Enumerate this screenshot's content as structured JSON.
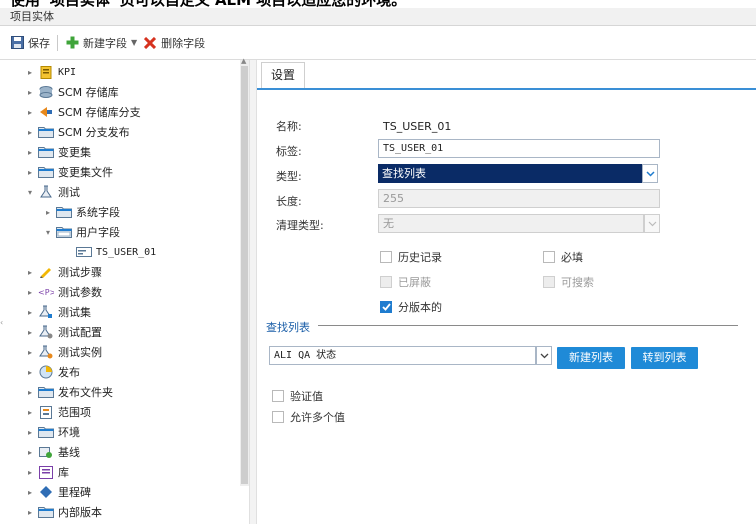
{
  "banner": {
    "text": "使用“项目实体”页可以自定义 ALM 项目以适应您的环境。"
  },
  "window": {
    "title": "项目实体"
  },
  "toolbar": {
    "save_label": "保存",
    "new_field_label": "新建字段",
    "delete_field_label": "删除字段"
  },
  "tree": {
    "items": [
      {
        "label": "KPI",
        "icon": "kpi-icon",
        "expander": "▸"
      },
      {
        "label": "SCM 存储库",
        "icon": "scm-repository-icon",
        "expander": "▸"
      },
      {
        "label": "SCM 存储库分支",
        "icon": "scm-branch-icon",
        "expander": "▸"
      },
      {
        "label": "SCM 分支发布",
        "icon": "folder-icon",
        "expander": "▸"
      },
      {
        "label": "变更集",
        "icon": "folder-icon",
        "expander": "▸"
      },
      {
        "label": "变更集文件",
        "icon": "folder-icon",
        "expander": "▸"
      },
      {
        "label": "测试",
        "icon": "test-icon",
        "expander": "▾"
      },
      {
        "label": "系统字段",
        "icon": "folder-icon",
        "expander": "▸"
      },
      {
        "label": "用户字段",
        "icon": "folder-open-icon",
        "expander": "▾"
      },
      {
        "label": "TS_USER_01",
        "icon": "field-icon",
        "expander": ""
      },
      {
        "label": "测试步骤",
        "icon": "test-step-icon",
        "expander": "▸"
      },
      {
        "label": "测试参数",
        "icon": "parameter-icon",
        "expander": "▸"
      },
      {
        "label": "测试集",
        "icon": "test-set-icon",
        "expander": "▸"
      },
      {
        "label": "测试配置",
        "icon": "test-config-icon",
        "expander": "▸"
      },
      {
        "label": "测试实例",
        "icon": "test-instance-icon",
        "expander": "▸"
      },
      {
        "label": "发布",
        "icon": "release-icon",
        "expander": "▸"
      },
      {
        "label": "发布文件夹",
        "icon": "folder-icon",
        "expander": "▸"
      },
      {
        "label": "范围项",
        "icon": "scope-item-icon",
        "expander": "▸"
      },
      {
        "label": "环境",
        "icon": "folder-icon",
        "expander": "▸"
      },
      {
        "label": "基线",
        "icon": "baseline-icon",
        "expander": "▸"
      },
      {
        "label": "库",
        "icon": "library-icon",
        "expander": "▸"
      },
      {
        "label": "里程碑",
        "icon": "milestone-icon",
        "expander": "▸"
      },
      {
        "label": "内部版本",
        "icon": "folder-icon",
        "expander": "▸"
      }
    ]
  },
  "tabs": {
    "settings": "设置"
  },
  "form": {
    "name_label": "名称:",
    "name_value": "TS_USER_01",
    "tag_label": "标签:",
    "tag_value": "TS_USER_01",
    "type_label": "类型:",
    "type_value": "查找列表",
    "length_label": "长度:",
    "length_value": "255",
    "clean_type_label": "清理类型:",
    "clean_type_value": "无",
    "history_label": "历史记录",
    "required_label": "必填",
    "masked_label": "已屏蔽",
    "searchable_label": "可搜索",
    "versioned_label": "分版本的",
    "versioned_checked": true
  },
  "lookup": {
    "section_title": "查找列表",
    "list_value": "ALI QA 状态",
    "new_list_button": "新建列表",
    "goto_list_button": "转到列表",
    "verify_label": "验证值",
    "multi_label": "允许多个值"
  },
  "colors": {
    "accent": "#1f8ad7",
    "selection": "#0a2b66",
    "section_title": "#1a5ea8"
  }
}
